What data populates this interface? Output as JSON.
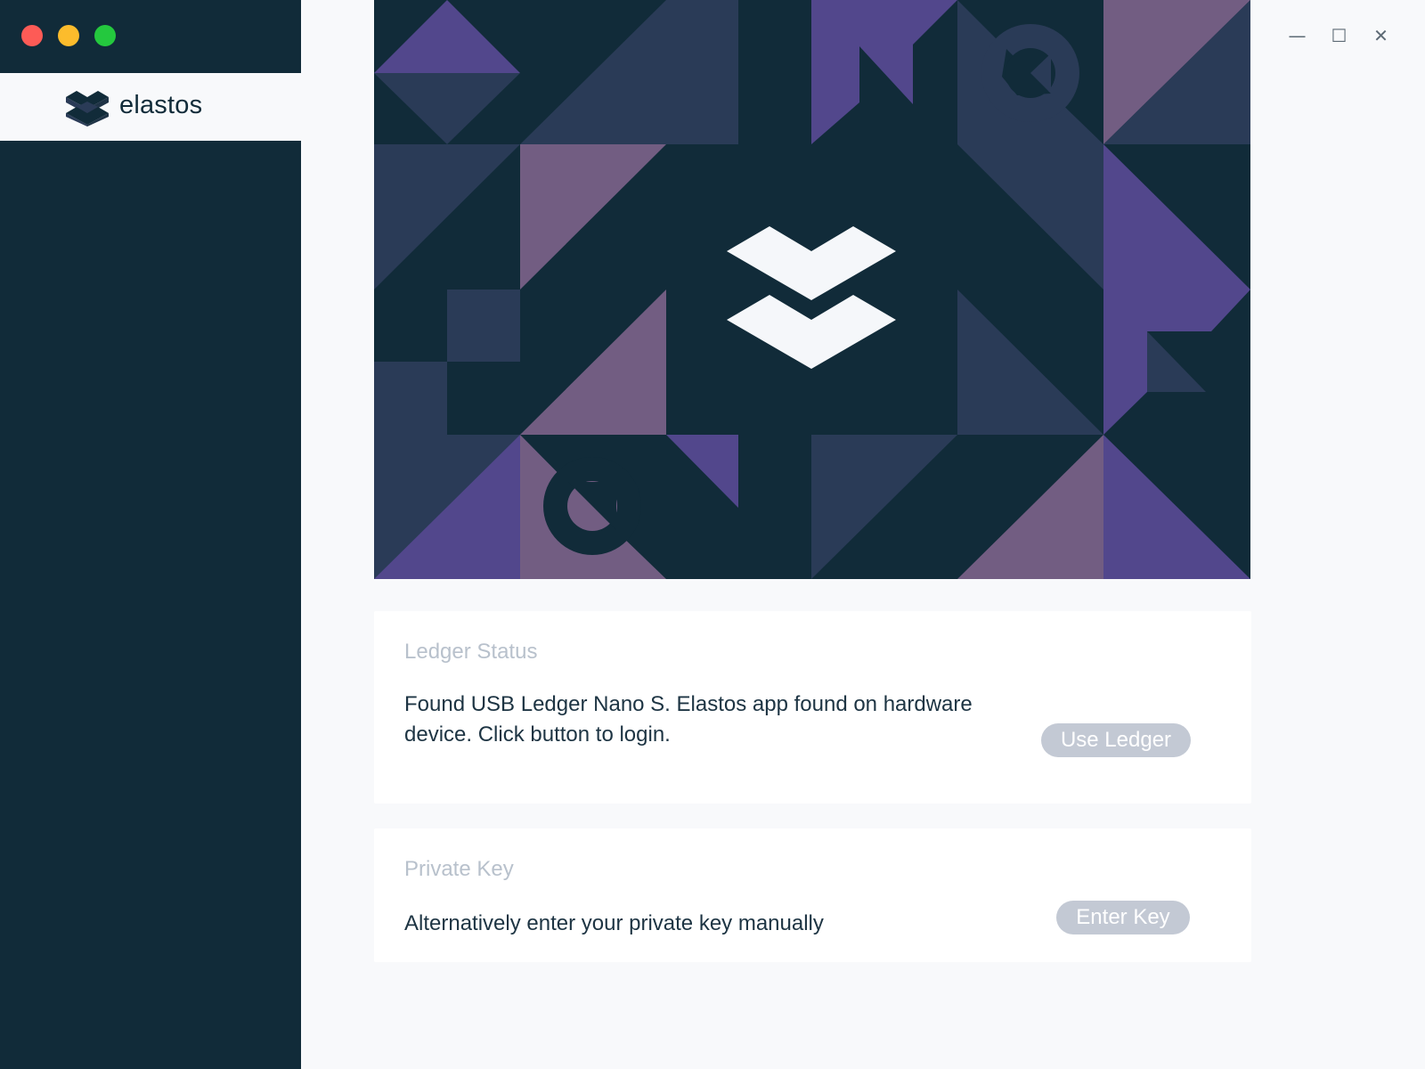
{
  "window": {
    "controls": {
      "minimize_glyph": "—",
      "maximize_glyph": "☐",
      "close_glyph": "✕"
    }
  },
  "sidebar": {
    "brand_name": "elastos",
    "logo_icon": "elastos-logo-icon"
  },
  "hero": {
    "logo_icon": "elastos-logo-icon",
    "colors": {
      "base": "#112b39",
      "slate": "#2a3b57",
      "violet": "#52478c",
      "mauve": "#725d82",
      "logo": "#f5f7fa"
    }
  },
  "ledger_card": {
    "title": "Ledger Status",
    "message": "Found USB Ledger Nano S. Elastos app found on hardware device. Click button to login.",
    "button_label": "Use Ledger"
  },
  "key_card": {
    "title": "Private Key",
    "message": "Alternatively enter your private key manually",
    "button_label": "Enter Key"
  },
  "colors": {
    "sidebar_bg": "#112b39",
    "content_bg": "#f8f9fb",
    "button_bg": "#c3c9d4",
    "title_text": "#b8c1cc",
    "body_text": "#1d3443"
  }
}
